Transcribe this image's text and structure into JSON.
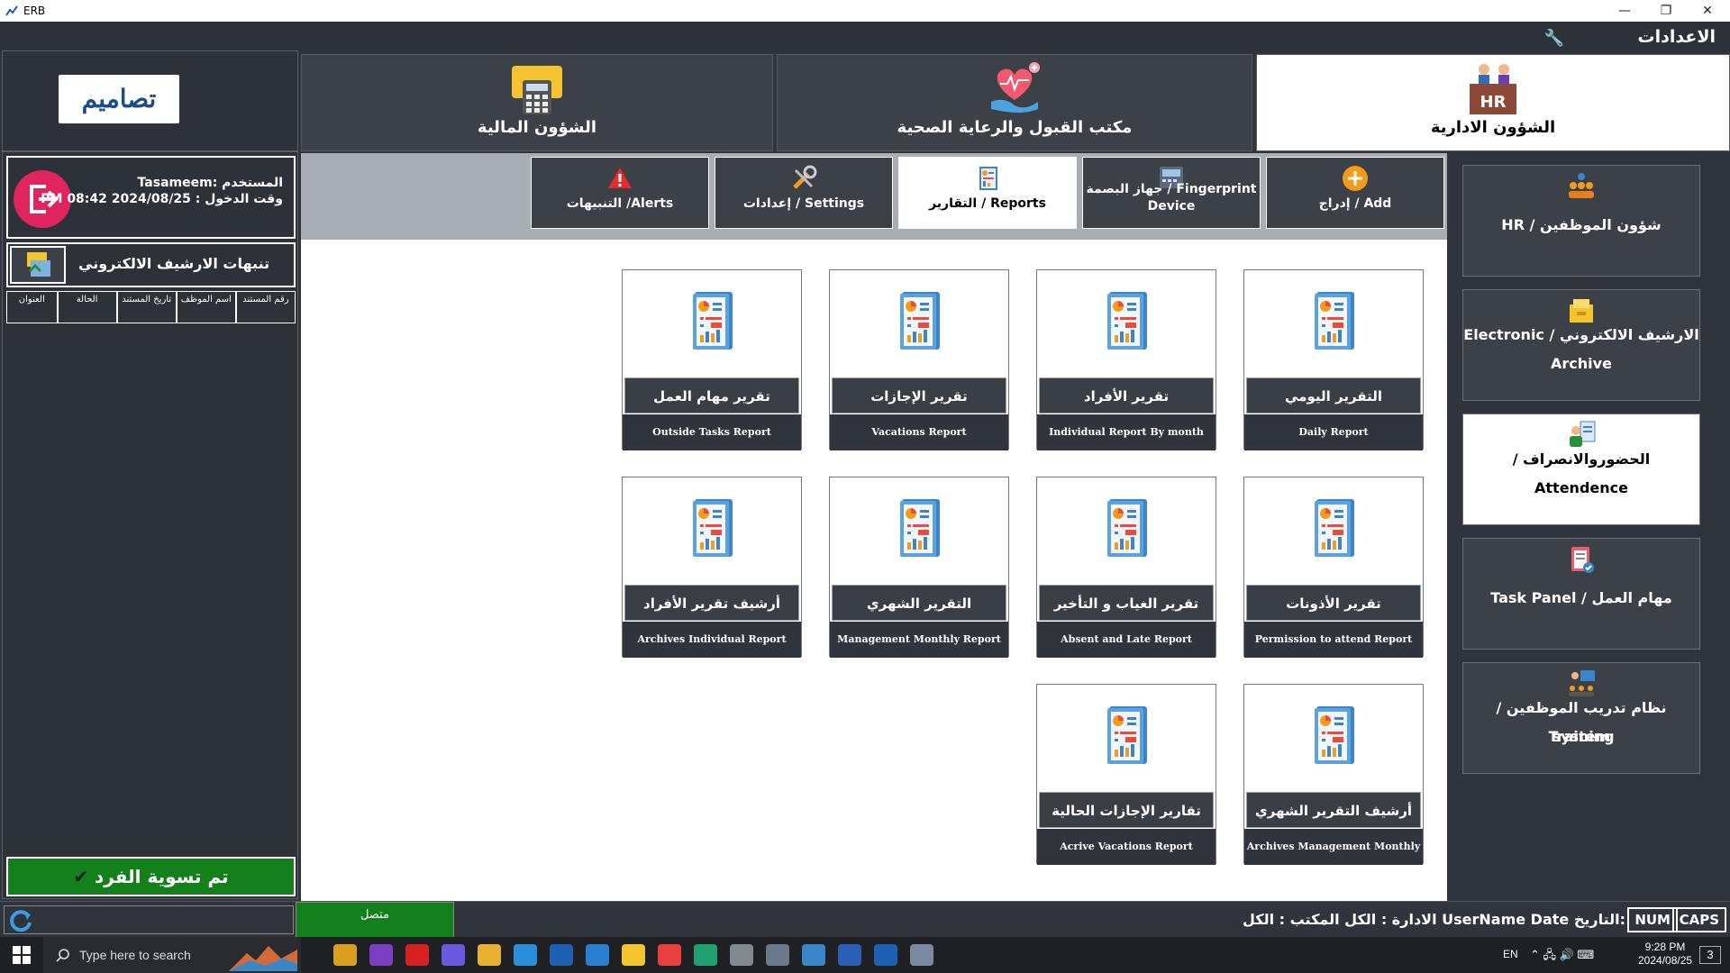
{
  "window": {
    "title": "ERB",
    "minimize": "—",
    "restore": "❐",
    "close": "✕"
  },
  "settings": {
    "label": "الاعدادات"
  },
  "modules": [
    {
      "label": "الشؤون الادارية",
      "icon": "hr-icon"
    },
    {
      "label": "مكتب القبول والرعاية الصحية",
      "icon": "health-care-icon"
    },
    {
      "label": "الشؤون المالية",
      "icon": "finance-calculator-icon"
    }
  ],
  "brand": {
    "logo_text": "تصاميم",
    "hr_badge": "HR"
  },
  "user": {
    "name_line": "المستخدم :Tasameem",
    "login_line": "وقت الدخول : PM 08:42 2024/08/25"
  },
  "archive_alerts": {
    "title": "تنبهات الارشيف الالكتروني",
    "columns": [
      "رقم المستند",
      "اسم الموظف",
      "تاريخ المستند",
      "الحالة",
      "العنوان"
    ]
  },
  "settle_button": {
    "label": "تم تسوية الفرد"
  },
  "subtabs": [
    {
      "label": "Add / إدراج",
      "icon": "plus-circle-icon"
    },
    {
      "label": "Fingerprint / جهاز البصمة Device",
      "icon": "fingerprint-device-icon"
    },
    {
      "label": "Reports / التقارير",
      "icon": "reports-icon"
    },
    {
      "label": "Settings / إعدادات",
      "icon": "tools-icon"
    },
    {
      "label": "Alerts/ التنبيهات",
      "icon": "warning-icon"
    }
  ],
  "reports": [
    {
      "title": "التقرير اليومي",
      "sub": "Daily Report"
    },
    {
      "title": "تقرير الأفراد",
      "sub": "Individual Report By month"
    },
    {
      "title": "تقرير الإجازات",
      "sub": "Vacations Report"
    },
    {
      "title": "تقرير مهام العمل",
      "sub": "Outside Tasks Report"
    },
    {
      "title": "تقرير الأذونات",
      "sub": "Permission to attend Report"
    },
    {
      "title": "تقرير الغياب و التأخير",
      "sub": "Absent and Late Report"
    },
    {
      "title": "التقرير الشهري",
      "sub": "Management Monthly Report"
    },
    {
      "title": "أرشيف تقرير الأفراد",
      "sub": "Archives Individual Report"
    },
    {
      "title": "أرشيف التقرير الشهري",
      "sub": "Archives Management Monthly"
    },
    {
      "title": "تقارير الإجازات الحالية",
      "sub": "Acrive Vacations Report"
    }
  ],
  "sidebar": [
    {
      "line1": "شؤون الموظفين / HR",
      "line2": "",
      "icon": "employees-icon"
    },
    {
      "line1": "الارشيف الالكتروني / Electronic",
      "line2": "Archive",
      "icon": "archive-folder-icon"
    },
    {
      "line1": "الحضوروالانصراف /",
      "line2": "Attendence",
      "icon": "attendance-icon"
    },
    {
      "line1": "مهام العمل / Task Panel",
      "line2": "",
      "icon": "task-clipboard-icon"
    },
    {
      "line1": "نظام تدريب الموظفين / Training",
      "line2": "system",
      "icon": "training-icon"
    }
  ],
  "status": {
    "connected": "متصل",
    "info": "الادارة : الكل المكتب : الكل      UserName  Date  التاريخ:",
    "num": "NUM",
    "caps": "CAPS"
  },
  "taskbar": {
    "search_placeholder": "Type here to search",
    "lang": "EN",
    "time": "9:28 PM",
    "date": "2024/08/25",
    "notifications": "3"
  },
  "colors": {
    "accent_green": "#14801c",
    "dark_panel": "#30353d",
    "logout_pink": "#e0245e"
  }
}
